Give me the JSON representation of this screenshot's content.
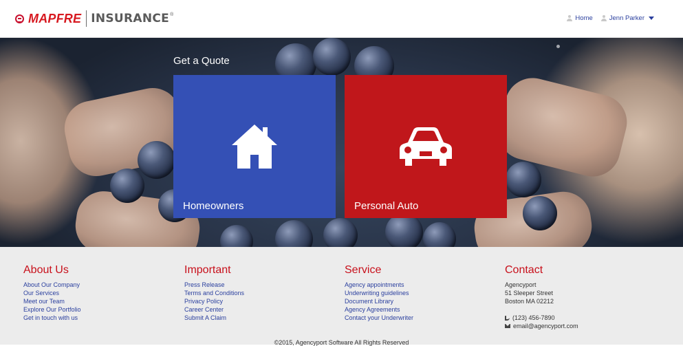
{
  "header": {
    "logo_brand": "MAPFRE",
    "logo_sub": "INSURANCE",
    "logo_reg": "®",
    "nav": {
      "home_label": "Home",
      "user_label": "Jenn Parker"
    }
  },
  "hero": {
    "title": "Get a Quote",
    "tiles": [
      {
        "label": "Homeowners",
        "icon": "house-icon",
        "color": "#3450b5"
      },
      {
        "label": "Personal Auto",
        "icon": "car-icon",
        "color": "#c0171b"
      }
    ]
  },
  "footer": {
    "about": {
      "heading": "About Us",
      "links": [
        "About Our Company",
        "Our Services",
        "Meet our Team",
        "Explore Our Portfolio",
        "Get in touch with us"
      ]
    },
    "important": {
      "heading": "Important",
      "links": [
        "Press Release",
        "Terms and Conditions",
        "Privacy Policy",
        "Career Center",
        "Submit A Claim"
      ]
    },
    "service": {
      "heading": "Service",
      "links": [
        "Agency appointments",
        "Underwriting guidelines",
        "Document Library",
        "Agency Agreements",
        "Contact your Underwriter"
      ]
    },
    "contact": {
      "heading": "Contact",
      "company": "Agencyport",
      "street": "51 Sleeper Street",
      "city": "Boston MA 02212",
      "phone": "(123) 456-7890",
      "email": "email@agencyport.com"
    },
    "copyright": "©2015, Agencyport Software All Rights Reserved"
  },
  "colors": {
    "brand_red": "#d71920",
    "link_blue": "#2a3f9e",
    "heading_red": "#c8101b"
  }
}
